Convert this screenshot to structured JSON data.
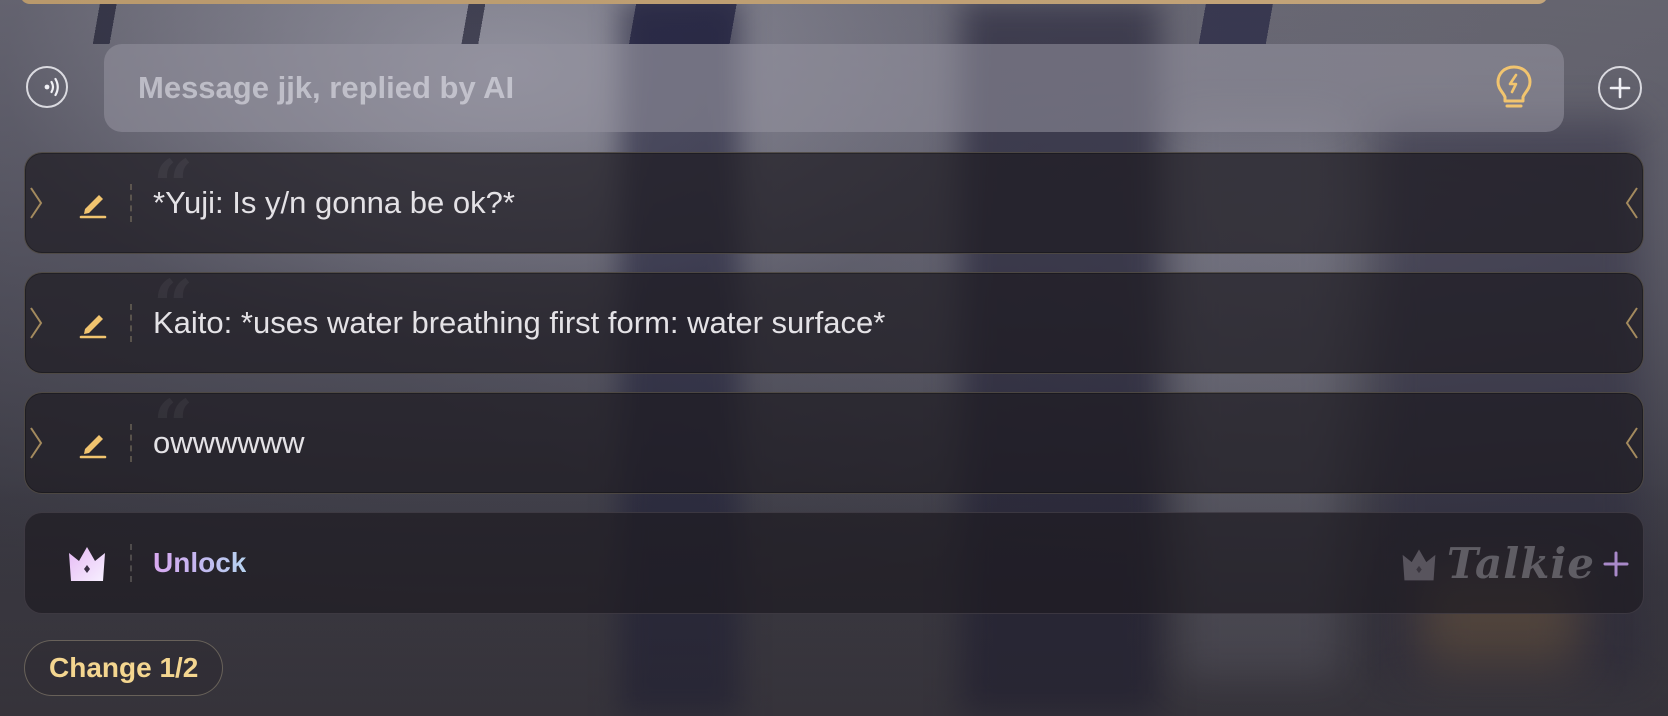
{
  "composer": {
    "placeholder": "Message jjk, replied by AI",
    "voice_icon": "voice-wave-icon",
    "hint_icon": "lightbulb-icon",
    "add_icon": "plus-circle-icon"
  },
  "suggestions": [
    {
      "text": "*Yuji: Is y/n gonna be ok?*",
      "icon": "pencil-edit-icon"
    },
    {
      "text": "Kaito: *uses water breathing first form: water surface*",
      "icon": "pencil-edit-icon"
    },
    {
      "text": "owwwwww",
      "icon": "pencil-edit-icon"
    }
  ],
  "unlock": {
    "label": "Unlock",
    "icon": "crown-icon",
    "brand": "Talkie",
    "brand_suffix": "+"
  },
  "change_button": {
    "label": "Change 1/2"
  },
  "colors": {
    "accent_gold": "#f4d690",
    "pencil_gold": "#f1c46f",
    "unlock_gradient_start": "#d9a9f0",
    "unlock_gradient_end": "#b7d3f0"
  }
}
